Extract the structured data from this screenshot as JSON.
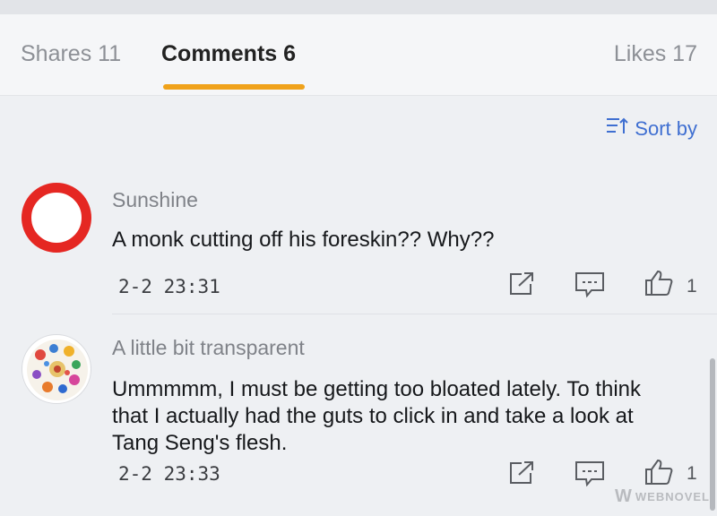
{
  "tabs": {
    "shares": "Shares 11",
    "comments": "Comments 6",
    "likes": "Likes 17"
  },
  "sort_label": "Sort by",
  "accent_color": "#f0a21b",
  "link_color": "#3f6fd1",
  "comments": [
    {
      "username": "Sunshine",
      "text": "A monk cutting off his foreskin?? Why??",
      "time": "2-2 23:31",
      "likes": "1",
      "avatar": "red-ring-avatar"
    },
    {
      "username": "A little bit transparent",
      "text": "Ummmmm, I must be getting too bloated lately. To think that I actually had the guts to click in and take a look at Tang Seng's flesh.",
      "time": "2-2 23:33",
      "likes": "1",
      "avatar": "colorful-pattern-avatar"
    }
  ],
  "watermark": {
    "logo": "W",
    "text": "WEBNOVEL"
  }
}
